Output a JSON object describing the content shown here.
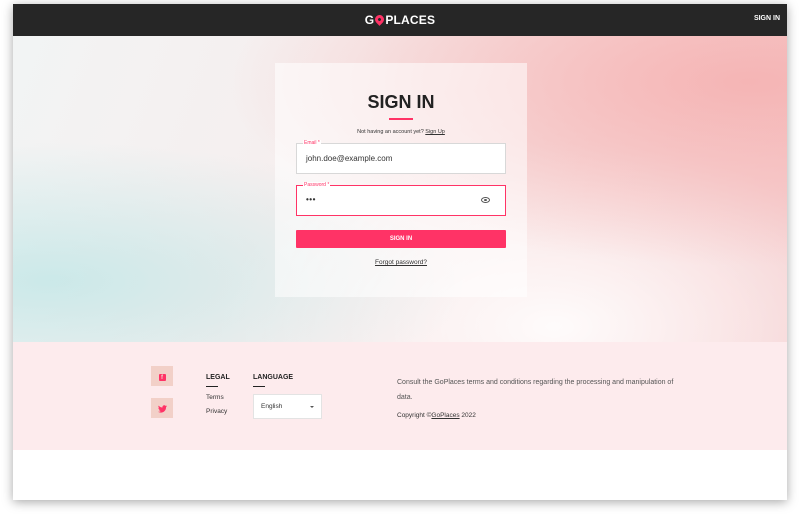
{
  "header": {
    "logo_left": "G",
    "logo_right": "PLACES",
    "signin_label": "SIGN IN"
  },
  "login": {
    "title": "SIGN IN",
    "no_account_text": "Not having an account yet? ",
    "signup_link": "Sign Up",
    "email_label": "Email *",
    "email_value": "john.doe@example.com",
    "password_label": "Password *",
    "password_value": "•••",
    "submit_label": "SIGN IN",
    "forgot_label": "Forgot password?"
  },
  "footer": {
    "legal_heading": "LEGAL",
    "terms_label": "Terms",
    "privacy_label": "Privacy",
    "language_heading": "LANGUAGE",
    "language_value": "English",
    "consult_text": "Consult the GoPlaces terms and conditions regarding the processing and manipulation of data.",
    "copyright_prefix": "Copyright ©",
    "copyright_brand": "GoPlaces",
    "copyright_year": " 2022",
    "social": [
      "facebook-icon",
      "twitter-icon"
    ]
  },
  "colors": {
    "accent": "#ff3366",
    "topbar": "#262626",
    "footer_bg": "#fdebed"
  }
}
